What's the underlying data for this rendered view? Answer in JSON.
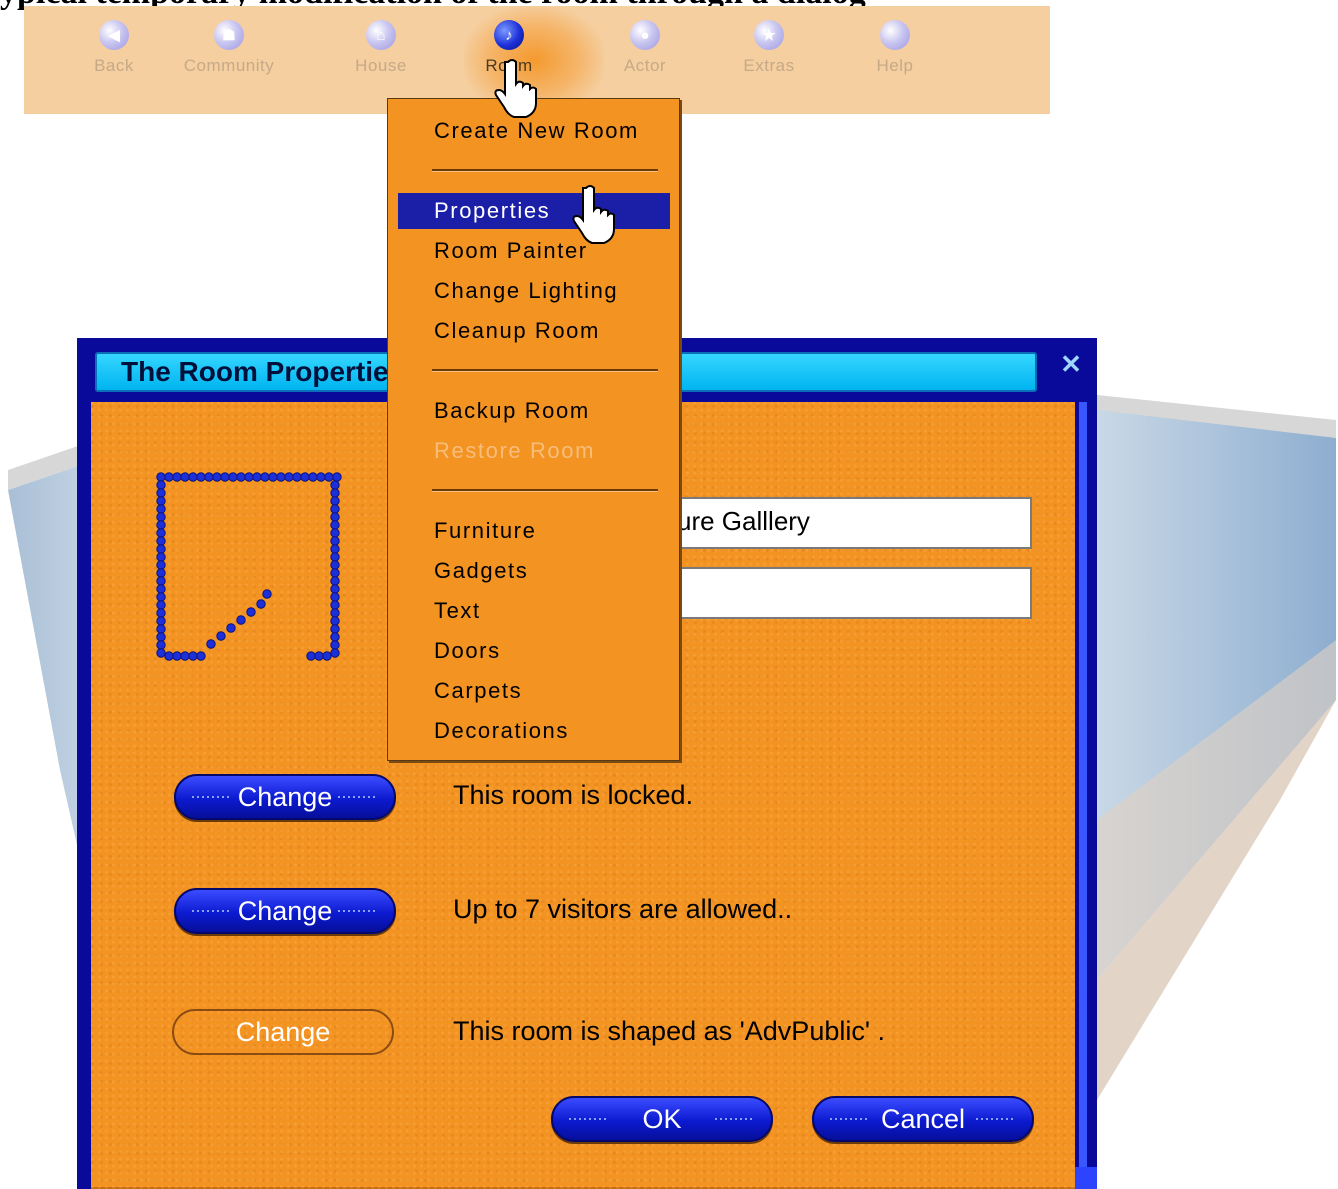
{
  "page_caption": "ypical temporary modification of the room through a dialog",
  "toolbar": {
    "items": [
      {
        "label": "Back",
        "icon": "back-arrow-icon",
        "glyph": "◀"
      },
      {
        "label": "Community",
        "icon": "community-icon",
        "glyph": "☗"
      },
      {
        "label": "House",
        "icon": "house-icon",
        "glyph": "⌂"
      },
      {
        "label": "Room",
        "icon": "room-icon",
        "glyph": "♪"
      },
      {
        "label": "Actor",
        "icon": "actor-icon",
        "glyph": "●"
      },
      {
        "label": "Extras",
        "icon": "extras-star-icon",
        "glyph": "★"
      },
      {
        "label": "Help",
        "icon": "help-icon",
        "glyph": ""
      }
    ],
    "active": "Room"
  },
  "menu": {
    "items": [
      {
        "label": "Create New Room",
        "state": "normal"
      },
      {
        "label": "Properties",
        "state": "highlight"
      },
      {
        "label": "Room Painter",
        "state": "normal"
      },
      {
        "label": "Change Lighting",
        "state": "normal"
      },
      {
        "label": "Cleanup Room",
        "state": "normal"
      },
      {
        "label": "Backup Room",
        "state": "normal"
      },
      {
        "label": "Restore Room",
        "state": "disabled"
      },
      {
        "label": "Furniture",
        "state": "normal"
      },
      {
        "label": "Gadgets",
        "state": "normal"
      },
      {
        "label": "Text",
        "state": "normal"
      },
      {
        "label": "Doors",
        "state": "normal"
      },
      {
        "label": "Carpets",
        "state": "normal"
      },
      {
        "label": "Decorations",
        "state": "normal"
      }
    ]
  },
  "dialog": {
    "title": "The Room Properties",
    "close_glyph": "✕",
    "name_field_value": "ure Galllery",
    "second_field_value": "",
    "rows": [
      {
        "button": "Change",
        "text": "This room is locked.",
        "enabled": true
      },
      {
        "button": "Change",
        "text": "Up to 7 visitors are allowed..",
        "enabled": true
      },
      {
        "button": "Change",
        "text": "This room is shaped as 'AdvPublic' .",
        "enabled": false
      }
    ],
    "ok_label": "OK",
    "cancel_label": "Cancel"
  },
  "colors": {
    "dialog_orange": "#f39322",
    "title_cyan": "#00b4f0",
    "frame_blue": "#0a0a9a",
    "button_blue": "#0c1ad0",
    "menu_highlight": "#1b1fa8",
    "toolbar_bg": "#f5cfa0"
  }
}
